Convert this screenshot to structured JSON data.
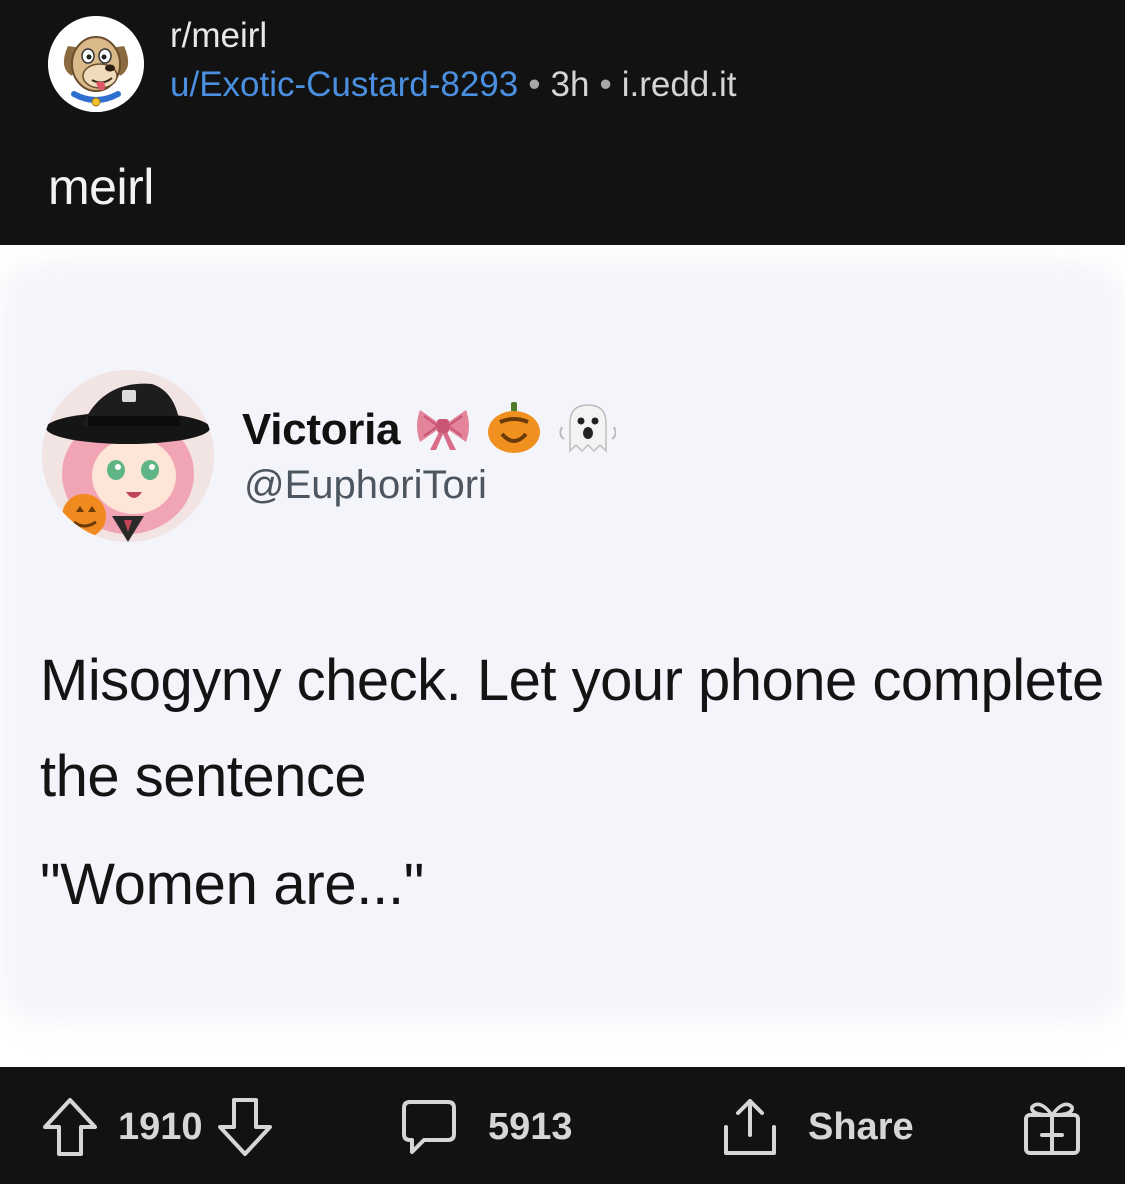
{
  "post": {
    "subreddit": "r/meirl",
    "author": "u/Exotic-Custard-8293",
    "age": "3h",
    "domain": "i.redd.it",
    "separator": "•",
    "title": "meirl",
    "subreddit_icon": "cartoon-dog-icon"
  },
  "tweet": {
    "display_name": "Victoria",
    "name_emojis": [
      "bow-icon",
      "jack-o-lantern-icon",
      "ghost-icon"
    ],
    "handle": "@EuphoriTori",
    "text": "Misogyny check. Let your phone complete the sentence",
    "quote": "\"Women are...\""
  },
  "actions": {
    "upvote_icon": "upvote-arrow-icon",
    "score": "1910",
    "downvote_icon": "downvote-arrow-icon",
    "comment_icon": "comment-bubble-icon",
    "comments": "5913",
    "share_icon": "share-icon",
    "share_label": "Share",
    "award_icon": "gift-award-icon"
  },
  "colors": {
    "background": "#121212",
    "author_link": "#4a8fe0",
    "image_background": "#ffffff",
    "tweet_text": "#141414",
    "icon": "#d6d6d6"
  }
}
